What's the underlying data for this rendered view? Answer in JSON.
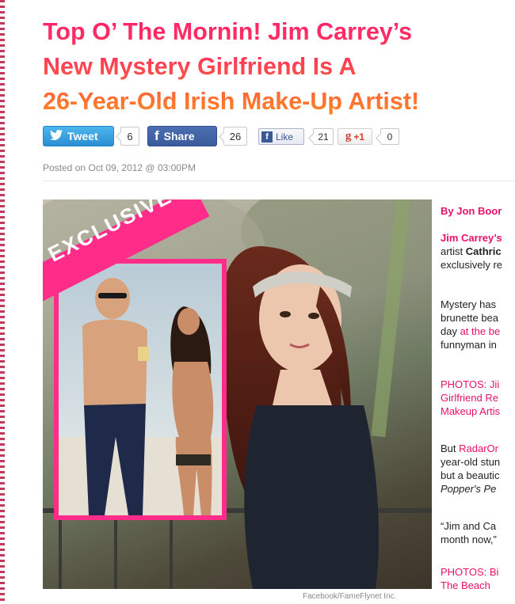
{
  "article": {
    "headline_line1": "Top O’ The Mornin! Jim Carrey’s",
    "headline_line2": "New Mystery Girlfriend Is A",
    "headline_line3": "26-Year-Old Irish Make-Up Artist!",
    "posted": "Posted on Oct 09, 2012 @ 03:00PM",
    "photo_badge": "EXCLUSIVE",
    "photo_credit": "Facebook/FameFlynet Inc."
  },
  "social": {
    "tweet_label": "Tweet",
    "tweet_count": "6",
    "share_label": "Share",
    "share_count": "26",
    "like_label": "Like",
    "like_count": "21",
    "gplus_label": "+1",
    "gplus_count": "0"
  },
  "sidebar_text": {
    "byline": "By Jon Boor",
    "p1_line1": "Jim Carrey’s",
    "p1_line2_a": "artist ",
    "p1_line2_b": "Cathric",
    "p1_line3": "exclusively re",
    "p2_line1": "Mystery has",
    "p2_line2": "brunette bea",
    "p2_line3_a": "day ",
    "p2_line3_b": "at the be",
    "p2_line4": "funnyman in",
    "p3_line1": "PHOTOS: Jii",
    "p3_line2": "Girlfriend Re",
    "p3_line3": "Makeup Artis",
    "p4_line1_a": "But ",
    "p4_line1_b": "RadarOr",
    "p4_line2": "year-old stun",
    "p4_line3": "but a beautic",
    "p4_line4": "Popper's Pe",
    "p5_line1": "“Jim and Ca",
    "p5_line2": "month now,”",
    "p6_line1": "PHOTOS: Bi",
    "p6_line2": "The Beach"
  },
  "colors": {
    "headline_top": "#ff1f6e",
    "headline_bottom": "#ff8a1e",
    "accent_pink": "#e8106b",
    "twitter_blue": "#2a8fd2",
    "facebook_blue": "#3b5998"
  },
  "icons": {
    "tweet": "twitter-bird-icon",
    "share": "facebook-icon",
    "like": "facebook-like-icon",
    "gplus": "google-plus-icon"
  }
}
